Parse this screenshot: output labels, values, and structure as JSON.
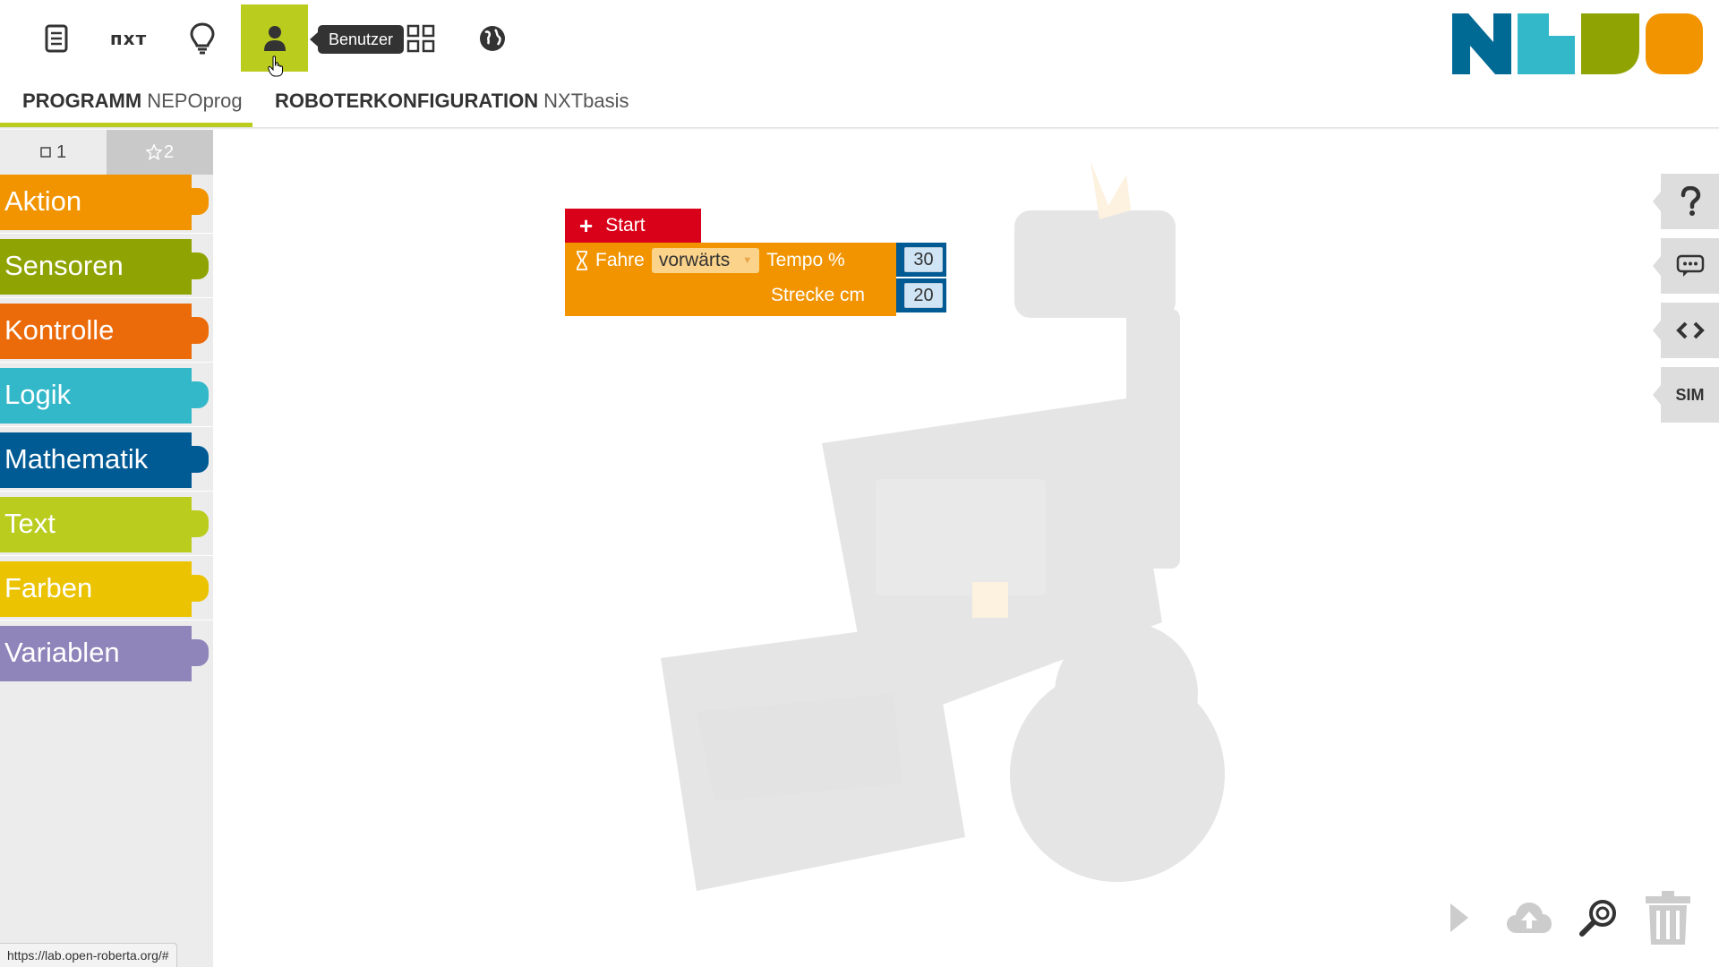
{
  "topbar": {
    "menu_icon": "document-icon",
    "robot_label": "пхт",
    "hint_icon": "lightbulb-icon",
    "user_icon": "user-icon",
    "gallery_icon": "grid-icon",
    "language_icon": "globe-icon",
    "tooltip": "Benutzer",
    "logo_colors": [
      "#006994",
      "#33b8ca",
      "#8fa402",
      "#f29400"
    ]
  },
  "tabs": {
    "program": {
      "label": "PROGRAMM",
      "name": "NEPOprog"
    },
    "robot": {
      "label": "ROBOTERKONFIGURATION",
      "name": "NXTbasis"
    }
  },
  "toolbox": {
    "levels": [
      {
        "label": "1",
        "icon": "square-icon"
      },
      {
        "label": "2",
        "icon": "star-icon"
      }
    ],
    "categories": [
      {
        "label": "Aktion",
        "color": "#f29400"
      },
      {
        "label": "Sensoren",
        "color": "#8fa402"
      },
      {
        "label": "Kontrolle",
        "color": "#eb6a0a"
      },
      {
        "label": "Logik",
        "color": "#33b8ca"
      },
      {
        "label": "Mathematik",
        "color": "#005a94"
      },
      {
        "label": "Text",
        "color": "#bacc1e"
      },
      {
        "label": "Farben",
        "color": "#ebc300"
      },
      {
        "label": "Variablen",
        "color": "#9085ba"
      }
    ]
  },
  "workspace": {
    "start_block": {
      "label": "Start"
    },
    "drive_block": {
      "label": "Fahre",
      "direction": "vorwärts",
      "speed_label": "Tempo %",
      "speed_value": "30",
      "distance_label": "Strecke cm",
      "distance_value": "20"
    }
  },
  "side_tools": {
    "help_icon": "question-icon",
    "comment_icon": "comment-icon",
    "code_icon": "code-icon",
    "sim_label": "SIM"
  },
  "bottom_tools": {
    "run_icon": "play-icon",
    "upload_icon": "cloud-upload-icon",
    "zoom_icon": "zoom-icon",
    "trash_icon": "trash-icon"
  },
  "status_url": "https://lab.open-roberta.org/#"
}
